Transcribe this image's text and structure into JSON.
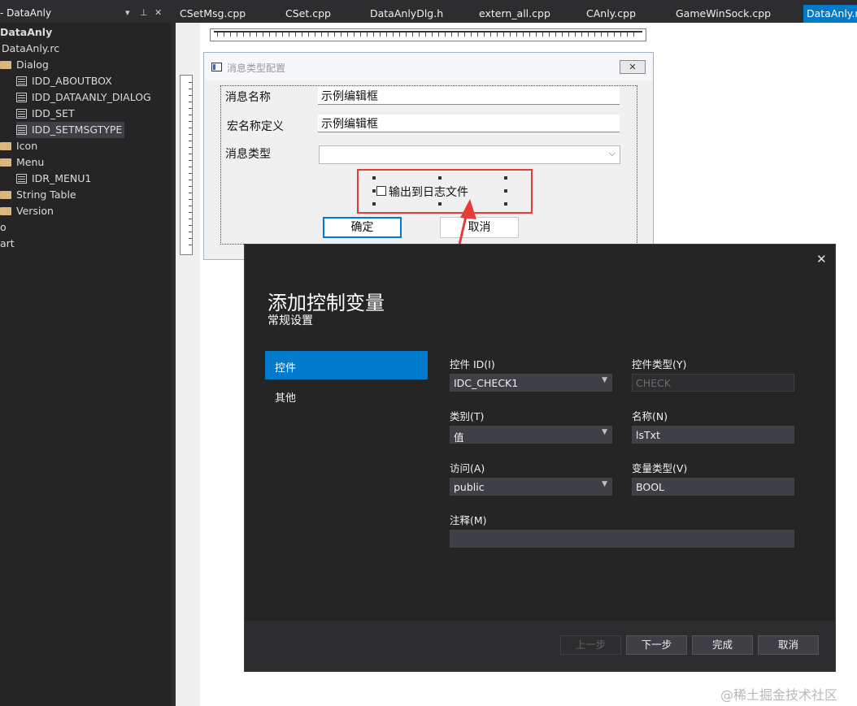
{
  "resource_view": {
    "title": "- DataAnly",
    "items": [
      {
        "label": "DataAnly"
      },
      {
        "label": "DataAnly.rc"
      },
      {
        "label": "Dialog"
      },
      {
        "label": "IDD_ABOUTBOX"
      },
      {
        "label": "IDD_DATAANLY_DIALOG"
      },
      {
        "label": "IDD_SET"
      },
      {
        "label": "IDD_SETMSGTYPE"
      },
      {
        "label": "Icon"
      },
      {
        "label": "Menu"
      },
      {
        "label": "IDR_MENU1"
      },
      {
        "label": "String Table"
      },
      {
        "label": "Version"
      },
      {
        "label": "o"
      },
      {
        "label": "art"
      }
    ]
  },
  "tabs": [
    {
      "label": "CSetMsg.cpp"
    },
    {
      "label": "CSet.cpp"
    },
    {
      "label": "DataAnlyDlg.h"
    },
    {
      "label": "extern_all.cpp"
    },
    {
      "label": "CAnly.cpp"
    },
    {
      "label": "GameWinSock.cpp"
    },
    {
      "label": "DataAnly.rc"
    }
  ],
  "design_dialog": {
    "title": "消息类型配置",
    "name_label": "消息名称",
    "name_value": "示例编辑框",
    "macro_label": "宏名称定义",
    "macro_value": "示例编辑框",
    "type_label": "消息类型",
    "type_value": "",
    "checkbox_label": "输出到日志文件",
    "ok_label": "确定",
    "cancel_label": "取消"
  },
  "modal": {
    "title": "添加控制变量",
    "subtitle": "常规设置",
    "nav": [
      {
        "label": "控件"
      },
      {
        "label": "其他"
      }
    ],
    "fields": {
      "control_id": {
        "label": "控件 ID(I)",
        "value": "IDC_CHECK1"
      },
      "control_type": {
        "label": "控件类型(Y)",
        "value": "CHECK"
      },
      "category": {
        "label": "类别(T)",
        "value": "值"
      },
      "name": {
        "label": "名称(N)",
        "value": "lsTxt"
      },
      "access": {
        "label": "访问(A)",
        "value": "public"
      },
      "var_type": {
        "label": "变量类型(V)",
        "value": "BOOL"
      },
      "comment": {
        "label": "注释(M)",
        "value": ""
      }
    },
    "buttons": {
      "prev": "上一步",
      "next": "下一步",
      "finish": "完成",
      "cancel": "取消"
    }
  },
  "annotation_color": "#e63b3b",
  "accent_color": "#007acc",
  "watermark": "@稀土掘金技术社区"
}
